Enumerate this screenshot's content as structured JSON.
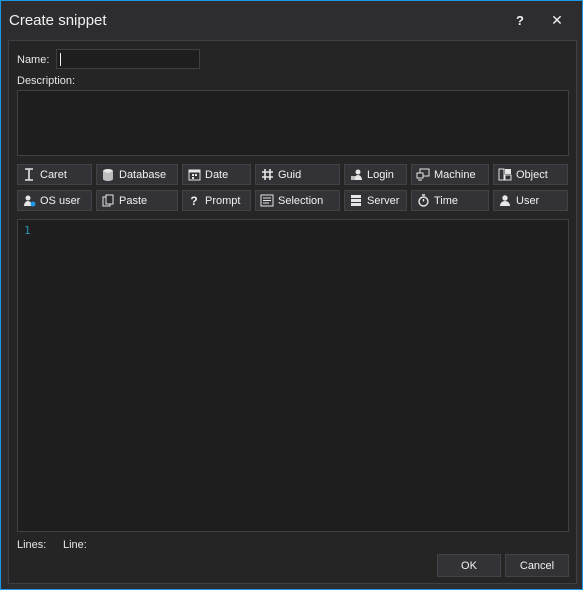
{
  "window": {
    "title": "Create snippet",
    "help_glyph": "?",
    "close_glyph": "✕"
  },
  "form": {
    "name_label": "Name:",
    "name_value": "",
    "description_label": "Description:"
  },
  "tokens": [
    {
      "label": "Caret",
      "icon": "caret-icon"
    },
    {
      "label": "Database",
      "icon": "database-icon"
    },
    {
      "label": "Date",
      "icon": "calendar-icon"
    },
    {
      "label": "Guid",
      "icon": "hash-icon"
    },
    {
      "label": "Login",
      "icon": "login-icon"
    },
    {
      "label": "Machine",
      "icon": "machine-icon"
    },
    {
      "label": "Object",
      "icon": "object-icon"
    },
    {
      "label": "OS user",
      "icon": "os-user-icon"
    },
    {
      "label": "Paste",
      "icon": "paste-icon"
    },
    {
      "label": "Prompt",
      "icon": "question-icon"
    },
    {
      "label": "Selection",
      "icon": "selection-icon"
    },
    {
      "label": "Server",
      "icon": "server-icon"
    },
    {
      "label": "Time",
      "icon": "stopwatch-icon"
    },
    {
      "label": "User",
      "icon": "user-icon"
    }
  ],
  "editor": {
    "line_number": "1"
  },
  "status": {
    "lines_label": "Lines:",
    "line_label": "Line:"
  },
  "buttons": {
    "ok": "OK",
    "cancel": "Cancel"
  }
}
